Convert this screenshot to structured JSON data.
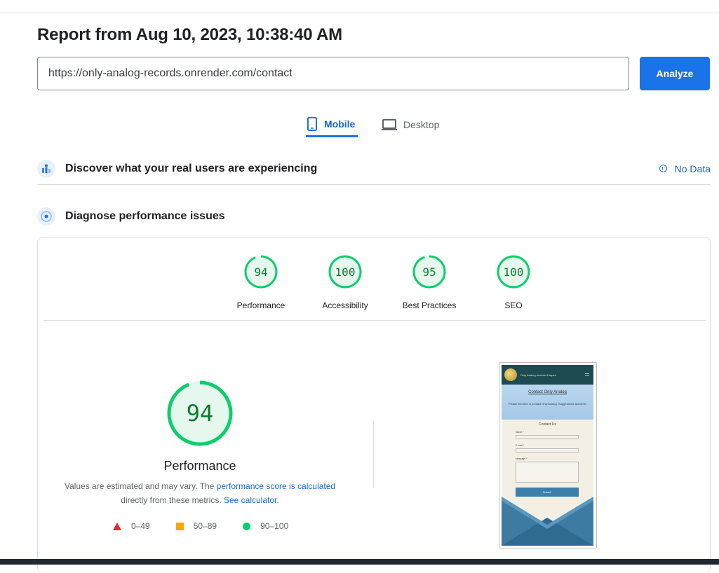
{
  "report": {
    "title": "Report from Aug 10, 2023, 10:38:40 AM",
    "url_value": "https://only-analog-records.onrender.com/contact",
    "analyze_label": "Analyze"
  },
  "tabs": [
    {
      "label": "Mobile",
      "icon": "phone-icon",
      "selected": true
    },
    {
      "label": "Desktop",
      "icon": "laptop-icon",
      "selected": false
    }
  ],
  "sections": {
    "real_users": {
      "title": "Discover what your real users are experiencing",
      "status": "No Data"
    },
    "diagnose": {
      "title": "Diagnose performance issues"
    }
  },
  "scores": [
    {
      "value": "94",
      "label": "Performance"
    },
    {
      "value": "100",
      "label": "Accessibility"
    },
    {
      "value": "95",
      "label": "Best Practices"
    },
    {
      "value": "100",
      "label": "SEO"
    }
  ],
  "main_score": {
    "value": "94",
    "label": "Performance",
    "note_prefix": "Values are estimated and may vary. The ",
    "note_link1": "performance score is calculated",
    "note_middle": " directly from these metrics. ",
    "note_link2": "See calculator."
  },
  "legend": [
    {
      "range": "0–49",
      "shape": "triangle",
      "color": "#e8262e"
    },
    {
      "range": "50–89",
      "shape": "square",
      "color": "#ffa400"
    },
    {
      "range": "90–100",
      "shape": "circle",
      "color": "#0cce6b"
    }
  ],
  "screenshot": {
    "brand": "Only Analog records & tapes",
    "heading": "Contact Only Analog",
    "text": "Please feel free to contact Only Analog. Suggestions welcome!",
    "form_title": "Contact Us",
    "name_label": "Name *",
    "email_label": "E-mail *",
    "message_label": "Message *",
    "submit_label": "Submit"
  },
  "colors": {
    "accent": "#1a73e8",
    "pass": "#0cce6b",
    "pass_text": "#0c7a2f"
  }
}
